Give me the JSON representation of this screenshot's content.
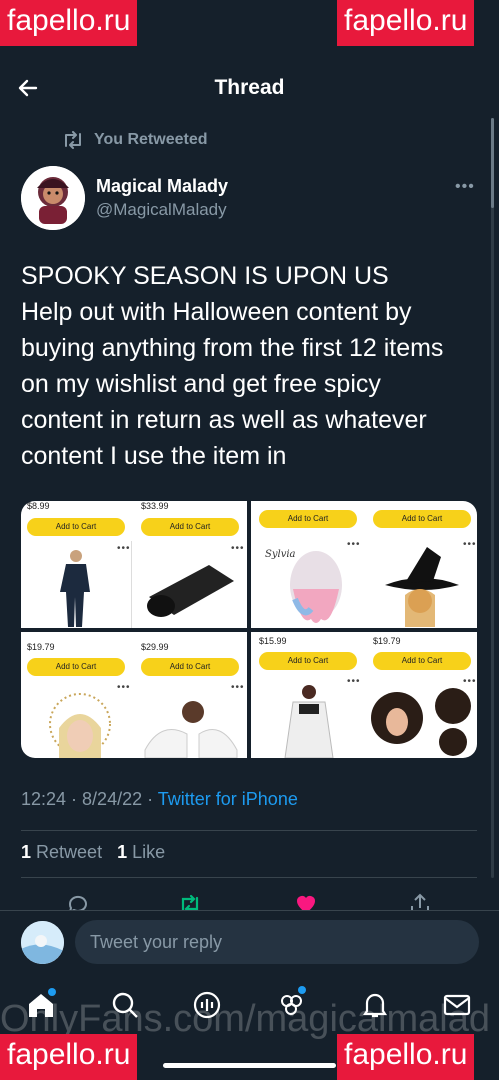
{
  "watermarks": {
    "top_left": "fapello.ru",
    "top_right": "fapello.ru",
    "bottom_left": "fapello.ru",
    "bottom_right": "fapello.ru",
    "overlay": "OnlyFans.com/magicalmalad"
  },
  "header": {
    "title": "Thread",
    "back_icon": "arrow-left-icon"
  },
  "retweet_context": {
    "label": "You Retweeted",
    "icon": "retweet-icon"
  },
  "author": {
    "name": "Magical Malady",
    "handle": "@MagicalMalady"
  },
  "tweet": {
    "lines": [
      "SPOOKY SEASON IS UPON US",
      "Help out with Halloween content by",
      "buying anything from the first 12 items",
      "on my wishlist and get free spicy",
      "content in return as well as whatever",
      "content I use the item in"
    ]
  },
  "media": {
    "add_to_cart": "Add to Cart",
    "tl": {
      "price_a": "$8.99",
      "price_b": "$33.99"
    },
    "tr": {
      "brand": "Sylvia"
    },
    "bl": {
      "price_a": "$19.79",
      "price_b": "$29.99"
    },
    "br": {
      "price_a": "$15.99",
      "price_b": "$19.79"
    }
  },
  "meta": {
    "time": "12:24",
    "date": "8/24/22",
    "separator": " · ",
    "source": "Twitter for iPhone"
  },
  "stats": {
    "retweet_count": "1",
    "retweet_label": "Retweet",
    "like_count": "1",
    "like_label": "Like"
  },
  "reply": {
    "placeholder": "Tweet your reply"
  },
  "colors": {
    "background": "#15202b",
    "accent": "#1d9bf0",
    "like": "#f91880",
    "retweet": "#00ba7c",
    "muted": "#8899a6",
    "watermark_bg": "#e8193c"
  }
}
